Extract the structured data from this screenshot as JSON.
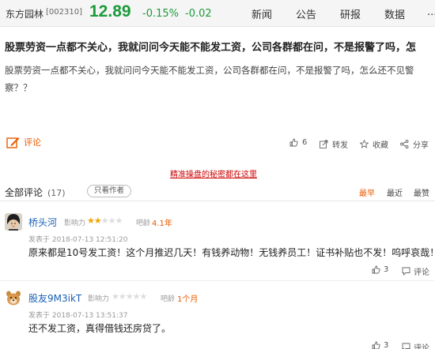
{
  "header": {
    "stock_name": "东方园林",
    "stock_code": "[002310]",
    "price": "12.89",
    "change_pct": "-0.15%",
    "change_abs": "-0.02",
    "price_color": "#1c9a3a",
    "nav": [
      "新闻",
      "公告",
      "研报",
      "数据",
      "..."
    ]
  },
  "post": {
    "title": "股票劳资一点都不关心，我就问问今天能不能发工资，公司各群都在问，不是报警了吗，怎",
    "body": "股票劳资一点都不关心，我就问问今天能不能发工资，公司各群都在问，不是报警了吗，怎么还不见警察？？"
  },
  "actions": {
    "comment_label": "评论",
    "like_count": "6",
    "share_label": "转发",
    "favorite_label": "收藏",
    "share2_label": "分享",
    "accent_color": "#e85b00"
  },
  "promo": "精准操盘的秘密都在这里",
  "comments_section": {
    "title": "全部评论",
    "count": "(17)",
    "author_only": "只看作者",
    "sort": [
      "最早",
      "最近",
      "最赞"
    ],
    "sort_active": 0
  },
  "comments": [
    {
      "username": "桥头河",
      "influence_label": "影响力",
      "rating": 2,
      "rating_max": 5,
      "age_label": "吧龄",
      "age": "4.1年",
      "time": "发表于 2018-07-13 12:51:20",
      "text": "原来都是10号发工资！这个月推迟几天！有钱养动物！无钱养员工！证书补贴也不发！呜呼哀哉！",
      "likes": "3",
      "reply_label": "评论"
    },
    {
      "username": "股友9M3ikT",
      "influence_label": "影响力",
      "rating": 0,
      "rating_max": 5,
      "age_label": "吧龄",
      "age": "1个月",
      "time": "发表于 2018-07-13 13:51:37",
      "text": "还不发工资，真得借钱还房贷了。",
      "likes": "3",
      "reply_label": "评论"
    }
  ]
}
